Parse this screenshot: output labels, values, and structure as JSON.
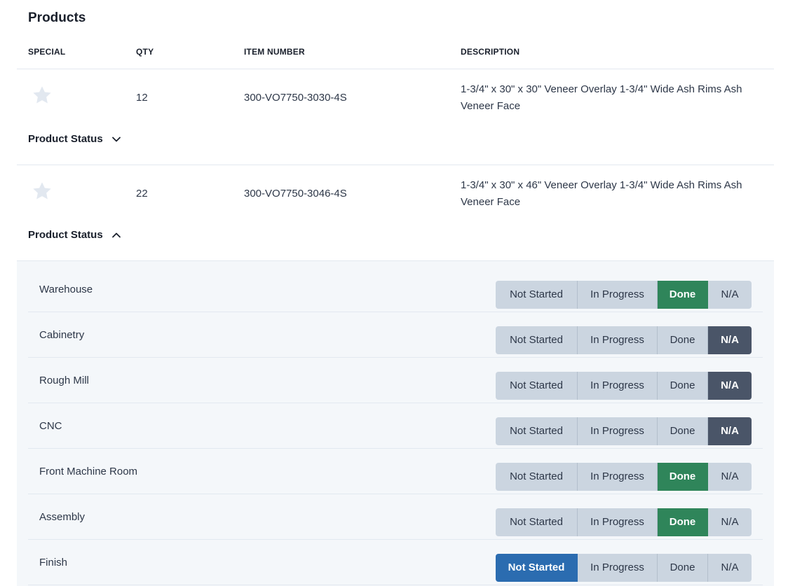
{
  "section_title": "Products",
  "columns": {
    "special": "SPECIAL",
    "qty": "QTY",
    "item_number": "ITEM NUMBER",
    "description": "DESCRIPTION"
  },
  "products": [
    {
      "special_icon": "star-icon",
      "starred": false,
      "qty": "12",
      "item_number": "300-VO7750-3030-4S",
      "description": "1-3/4\" x 30\" x 30\" Veneer Overlay 1-3/4\" Wide Ash Rims Ash Veneer Face",
      "status_toggle_label": "Product Status",
      "expanded": false,
      "toggle_icon": "chevron-down-icon"
    },
    {
      "special_icon": "star-icon",
      "starred": false,
      "qty": "22",
      "item_number": "300-VO7750-3046-4S",
      "description": "1-3/4\" x 30\" x 46\" Veneer Overlay 1-3/4\" Wide Ash Rims Ash Veneer Face",
      "status_toggle_label": "Product Status",
      "expanded": true,
      "toggle_icon": "chevron-up-icon"
    }
  ],
  "status_options": [
    "Not Started",
    "In Progress",
    "Done",
    "N/A"
  ],
  "status_rows": [
    {
      "label": "Warehouse",
      "selected": "Done"
    },
    {
      "label": "Cabinetry",
      "selected": "N/A"
    },
    {
      "label": "Rough Mill",
      "selected": "N/A"
    },
    {
      "label": "CNC",
      "selected": "N/A"
    },
    {
      "label": "Front Machine Room",
      "selected": "Done"
    },
    {
      "label": "Assembly",
      "selected": "Done"
    },
    {
      "label": "Finish",
      "selected": "Not Started"
    }
  ],
  "colors": {
    "done": "#2f855a",
    "na": "#4a5568",
    "not_started": "#2b6cb0",
    "inactive": "#cbd5e0",
    "star": "#e2e8f0",
    "panel_bg": "#f4f7fa"
  }
}
